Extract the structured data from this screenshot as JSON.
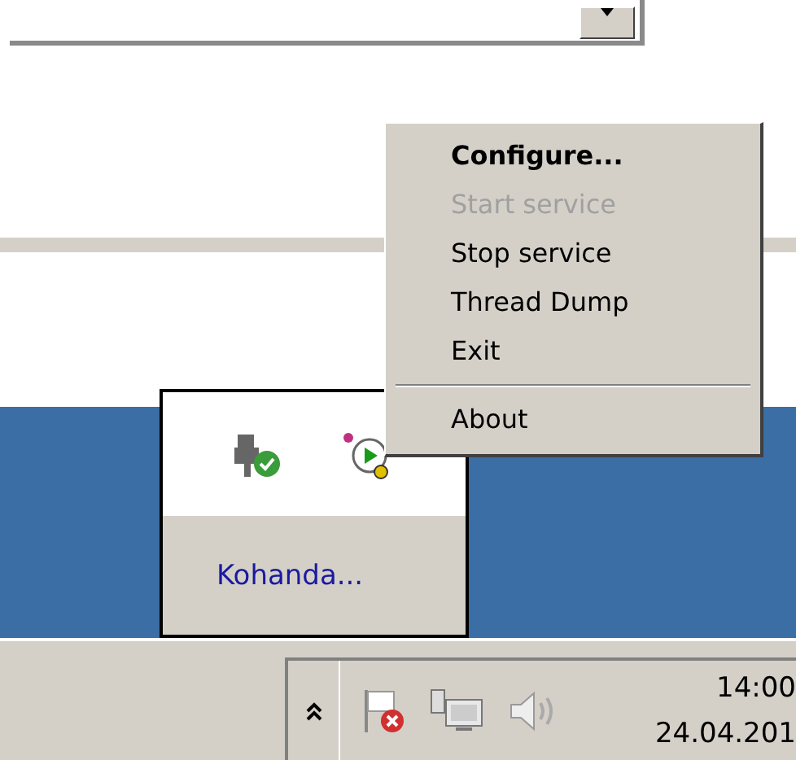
{
  "menu": {
    "items": [
      {
        "kind": "item",
        "label": "Configure...",
        "default": true,
        "disabled": false
      },
      {
        "kind": "item",
        "label": "Start service",
        "default": false,
        "disabled": true
      },
      {
        "kind": "item",
        "label": "Stop service",
        "default": false,
        "disabled": false
      },
      {
        "kind": "item",
        "label": "Thread Dump",
        "default": false,
        "disabled": false
      },
      {
        "kind": "item",
        "label": "Exit",
        "default": false,
        "disabled": false
      },
      {
        "kind": "separator"
      },
      {
        "kind": "item",
        "label": "About",
        "default": false,
        "disabled": false
      }
    ]
  },
  "tray_overflow": {
    "label": "Kohanda..."
  },
  "clock": {
    "time": "14:00",
    "date": "24.04.201"
  }
}
